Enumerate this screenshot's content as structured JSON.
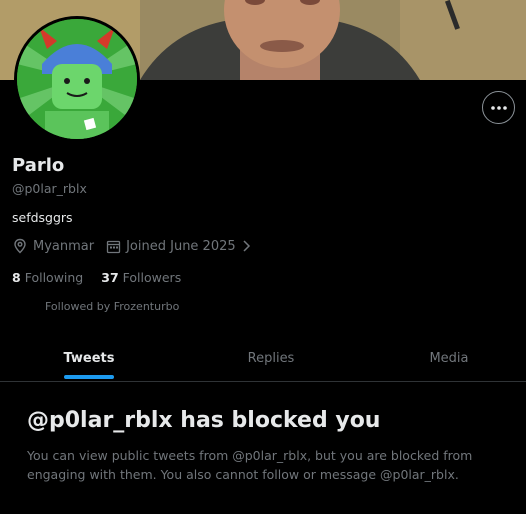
{
  "profile": {
    "name": "Parlo",
    "handle": "@p0lar_rblx",
    "bio": "sefdsggrs",
    "location": "Myanmar",
    "joined": "Joined June 2025",
    "following_count": "8",
    "following_label": "Following",
    "followers_count": "37",
    "followers_label": "Followers",
    "followed_by": "Followed by Frozenturbo"
  },
  "icons": {
    "more": "more-horizontal-icon",
    "location": "map-pin-icon",
    "calendar": "calendar-icon",
    "chevron": "chevron-right-icon"
  },
  "tabs": [
    {
      "label": "Tweets",
      "active": true
    },
    {
      "label": "Replies",
      "active": false
    },
    {
      "label": "Media",
      "active": false
    }
  ],
  "blocked": {
    "title": "@p0lar_rblx has blocked you",
    "message": "You can view public tweets from @p0lar_rblx, but you are blocked from engaging with them. You also cannot follow or message @p0lar_rblx."
  },
  "colors": {
    "background": "#000000",
    "text_primary": "#e7e9ea",
    "text_secondary": "#71767b",
    "accent": "#1d9bf0",
    "border": "#2f3336"
  }
}
